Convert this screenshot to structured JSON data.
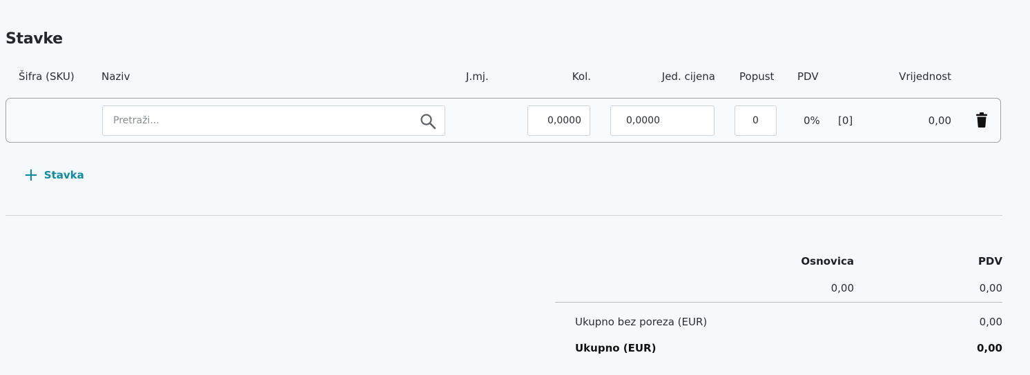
{
  "section": {
    "title": "Stavke"
  },
  "columns": {
    "sku": "Šifra (SKU)",
    "naziv": "Naziv",
    "jmj": "J.mj.",
    "kol": "Kol.",
    "cijena": "Jed. cijena",
    "popust": "Popust",
    "pdv": "PDV",
    "vrijednost": "Vrijednost"
  },
  "item": {
    "search_placeholder": "Pretraži...",
    "kol": "0,0000",
    "cijena": "0,0000",
    "popust": "0",
    "pdv_percent": "0%",
    "pdv_code": "[0]",
    "vrijednost": "0,00",
    "icons": {
      "search": "search-icon",
      "delete": "trash-icon"
    }
  },
  "add_item": {
    "icon": "plus-icon",
    "label": "Stavka"
  },
  "totals": {
    "header_osnovica": "Osnovica",
    "header_pdv": "PDV",
    "osnovica": "0,00",
    "pdv": "0,00",
    "subtotal_label": "Ukupno bez poreza (EUR)",
    "subtotal_value": "0,00",
    "total_label": "Ukupno (EUR)",
    "total_value": "0,00"
  },
  "colors": {
    "accent": "#0f8aa3",
    "background": "#f6f9fc"
  }
}
